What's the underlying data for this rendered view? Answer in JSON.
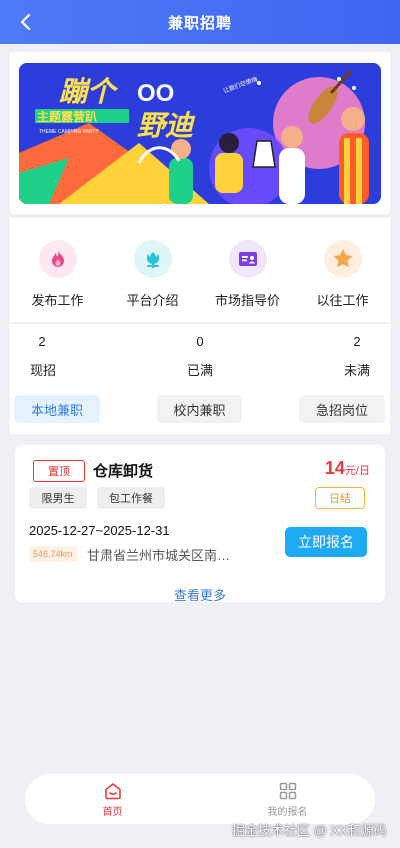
{
  "header": {
    "title": "兼职招聘"
  },
  "shortcuts": [
    {
      "label": "发布工作",
      "icon": "flame-icon",
      "color": "#e94b8a"
    },
    {
      "label": "平台介绍",
      "icon": "flower-icon",
      "color": "#2cc4d9"
    },
    {
      "label": "市场指导价",
      "icon": "id-card-icon",
      "color": "#7b3fe0"
    },
    {
      "label": "以往工作",
      "icon": "star-icon",
      "color": "#f7a64a"
    }
  ],
  "stats": [
    {
      "value": "2",
      "label": "现招"
    },
    {
      "value": "0",
      "label": "已满"
    },
    {
      "value": "2",
      "label": "未满"
    }
  ],
  "tabs": [
    {
      "label": "本地兼职",
      "active": true
    },
    {
      "label": "校内兼职",
      "active": false
    },
    {
      "label": "急招岗位",
      "active": false
    }
  ],
  "job": {
    "badge": "置顶",
    "title": "仓库卸货",
    "salary": "14",
    "salary_unit": "元/日",
    "tags": [
      "限男生",
      "包工作餐"
    ],
    "pay_type": "日结",
    "dates": "2025-12-27~2025-12-31",
    "distance": "546.74km",
    "address": "甘肃省兰州市城关区南关十字",
    "apply_label": "立即报名"
  },
  "more_label": "查看更多",
  "tabbar": [
    {
      "label": "首页",
      "icon": "home-icon",
      "active": true
    },
    {
      "label": "我的报名",
      "icon": "grid-icon",
      "active": false
    }
  ],
  "watermark": "掘金技术社区 @ XX和源码",
  "colors": {
    "primary": "#4f7af8",
    "accent_red": "#e53b3b",
    "apply_blue": "#1fa9f2",
    "active_tab_text": "#2f7de1"
  }
}
